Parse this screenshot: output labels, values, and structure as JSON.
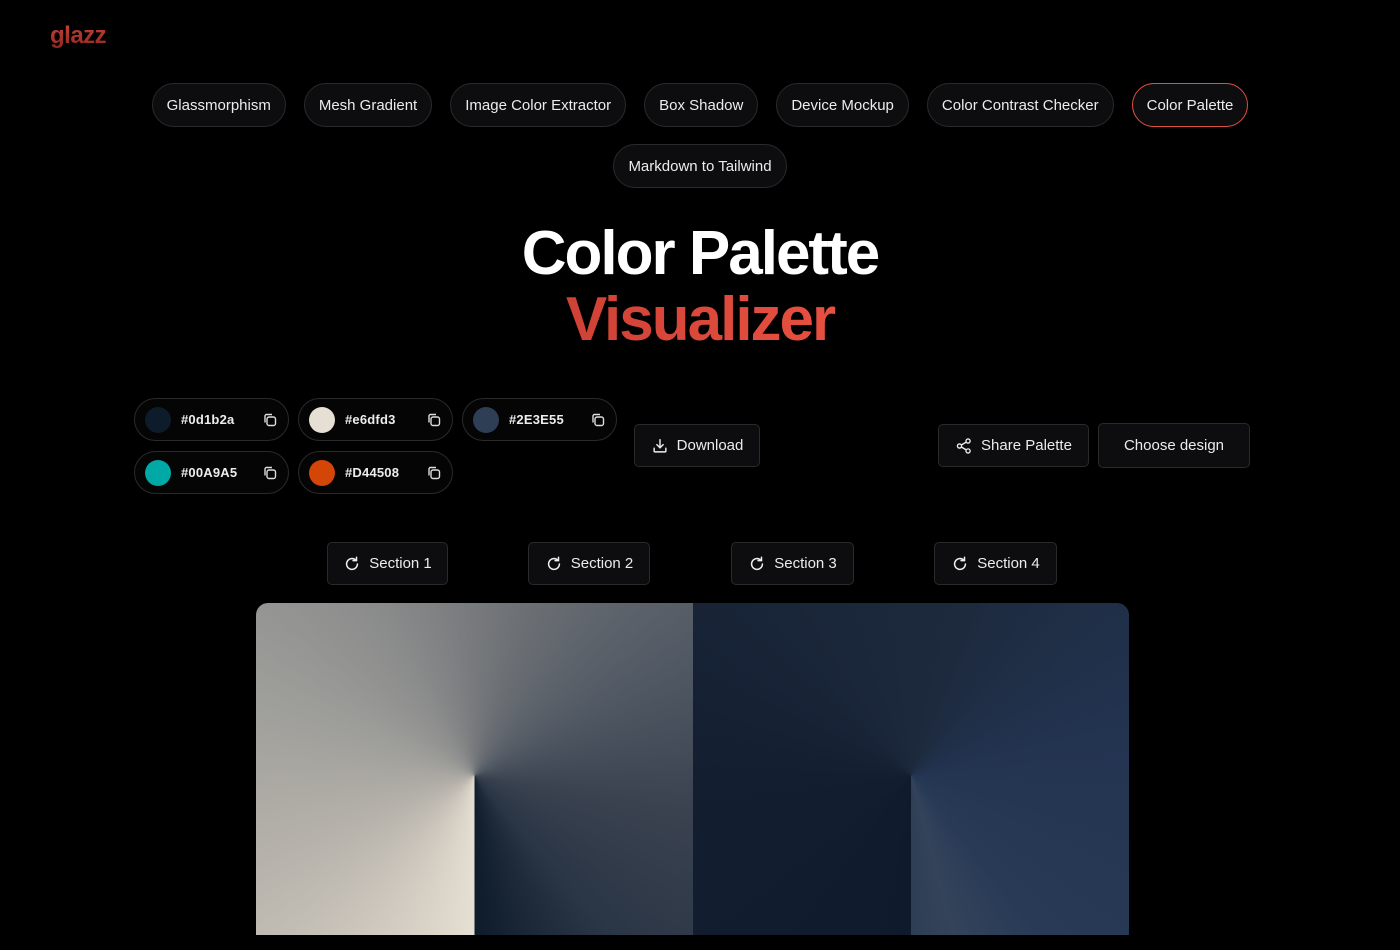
{
  "brand": {
    "logo": "glazz"
  },
  "nav": {
    "items": [
      {
        "label": "Glassmorphism",
        "active": false
      },
      {
        "label": "Mesh Gradient",
        "active": false
      },
      {
        "label": "Image Color Extractor",
        "active": false
      },
      {
        "label": "Box Shadow",
        "active": false
      },
      {
        "label": "Device Mockup",
        "active": false
      },
      {
        "label": "Color Contrast Checker",
        "active": false
      },
      {
        "label": "Color Palette",
        "active": true
      },
      {
        "label": "Markdown to Tailwind",
        "active": false
      }
    ],
    "active_color": "#e0503f"
  },
  "hero": {
    "line1": "Color Palette",
    "line2": "Visualizer"
  },
  "palette": [
    {
      "hex": "#0d1b2a",
      "color": "#0d1b2a",
      "icon": "copy-icon"
    },
    {
      "hex": "#e6dfd3",
      "color": "#e6dfd3",
      "icon": "copy-icon"
    },
    {
      "hex": "#2E3E55",
      "color": "#2E3E55",
      "icon": "copy-icon"
    },
    {
      "hex": "#00A9A5",
      "color": "#00A9A5",
      "icon": "copy-icon"
    },
    {
      "hex": "#D44508",
      "color": "#D44508",
      "icon": "copy-icon"
    }
  ],
  "actions": {
    "download": {
      "label": "Download",
      "icon": "download-icon"
    },
    "share": {
      "label": "Share Palette",
      "icon": "share-icon"
    },
    "choose": {
      "label": "Choose design"
    }
  },
  "sections": [
    {
      "label": "Section 1",
      "icon": "refresh-icon"
    },
    {
      "label": "Section 2",
      "icon": "refresh-icon"
    },
    {
      "label": "Section 3",
      "icon": "refresh-icon"
    },
    {
      "label": "Section 4",
      "icon": "refresh-icon"
    }
  ]
}
